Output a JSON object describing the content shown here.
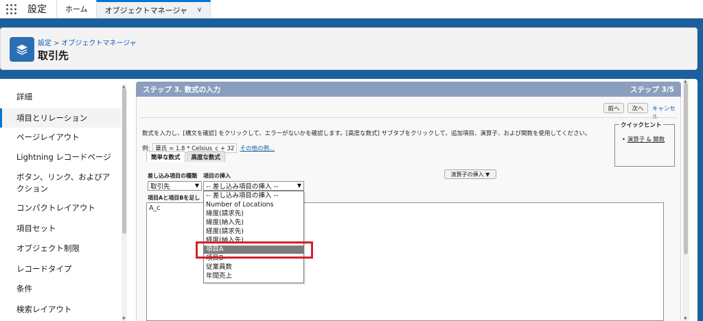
{
  "topbar": {
    "app_name": "設定",
    "tabs": [
      {
        "label": "ホーム"
      },
      {
        "label": "オブジェクトマネージャ"
      }
    ]
  },
  "header": {
    "breadcrumb_root": "設定",
    "breadcrumb_sep": ">",
    "breadcrumb_current": "オブジェクトマネージャ",
    "title": "取引先"
  },
  "sidebar": {
    "items": [
      {
        "label": "詳細"
      },
      {
        "label": "項目とリレーション"
      },
      {
        "label": "ページレイアウト"
      },
      {
        "label": "Lightning レコードページ"
      },
      {
        "label": "ボタン、リンク、およびア"
      },
      {
        "label": "クション"
      },
      {
        "label": "コンパクトレイアウト"
      },
      {
        "label": "項目セット"
      },
      {
        "label": "オブジェクト制限"
      },
      {
        "label": "レコードタイプ"
      },
      {
        "label": "条件"
      },
      {
        "label": "検索レイアウト"
      }
    ]
  },
  "step": {
    "title": "ステップ 3. 数式の入力",
    "progress": "ステップ 3/5",
    "prev_label": "前へ",
    "next_label": "次へ",
    "cancel_label": "キャンセル"
  },
  "instructions": "数式を入力し、[構文を確認] をクリックして、エラーがないかを確認します。[高度な数式] サブタブをクリックして、追加項目、演算子、および関数を使用してください。",
  "example": {
    "label": "例:",
    "formula": "華氏 = 1.8 * Celsius_c + 32",
    "more_link": "その他の例..."
  },
  "quick_tips": {
    "title": "クイックヒント",
    "link": "演算子 & 関数"
  },
  "formula_tabs": [
    {
      "label": "簡単な数式"
    },
    {
      "label": "高度な数式"
    }
  ],
  "merge_field": {
    "type_label": "差し込み項目の種類",
    "type_value": "取引先",
    "insert_label": "項目の挿入",
    "insert_value": "-- 差し込み項目の挿入 --"
  },
  "operator_button": "演算子の挿入 ▼",
  "formula_area": {
    "label": "項目Aと項目Bを足し",
    "value": "A_c"
  },
  "dropdown_options": [
    {
      "label": "-- 差し込み項目の挿入 --"
    },
    {
      "label": "Number of Locations"
    },
    {
      "label": "緯度(請求先)"
    },
    {
      "label": "緯度(納入先)"
    },
    {
      "label": "経度(請求先)"
    },
    {
      "label": "経度(納入先)"
    },
    {
      "label": "項目A"
    },
    {
      "label": "項目B"
    },
    {
      "label": "従業員数"
    },
    {
      "label": "年間売上"
    }
  ],
  "selected_option_index": 6,
  "colors": {
    "accent": "#0176d3",
    "step_bar": "#8a9fbe",
    "highlight": "#d4202a",
    "page_background": "#1b5f9e"
  },
  "icons": {
    "app_launcher": "waffle-icon",
    "header": "layers-icon",
    "tab_menu": "chevron-down-icon"
  }
}
